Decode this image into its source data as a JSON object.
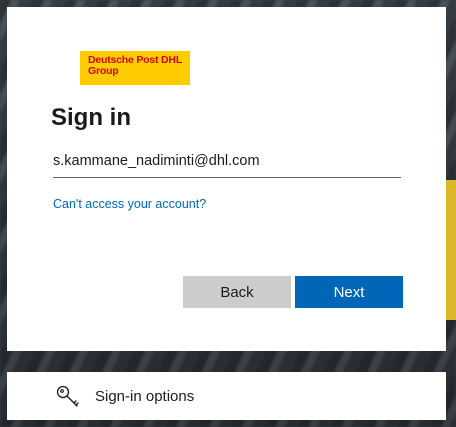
{
  "logo": {
    "line1": "Deutsche Post DHL",
    "line2": "Group"
  },
  "signin": {
    "title": "Sign in",
    "email_value": "s.kammane_nadiminti@dhl.com",
    "cant_access_link": "Can't access your account?",
    "back_label": "Back",
    "next_label": "Next"
  },
  "options": {
    "label": "Sign-in options",
    "icon": "key-icon"
  },
  "colors": {
    "accent": "#0067b8",
    "logo_bg": "#ffcc00",
    "logo_text": "#d40511",
    "back_bg": "#cccccc"
  }
}
